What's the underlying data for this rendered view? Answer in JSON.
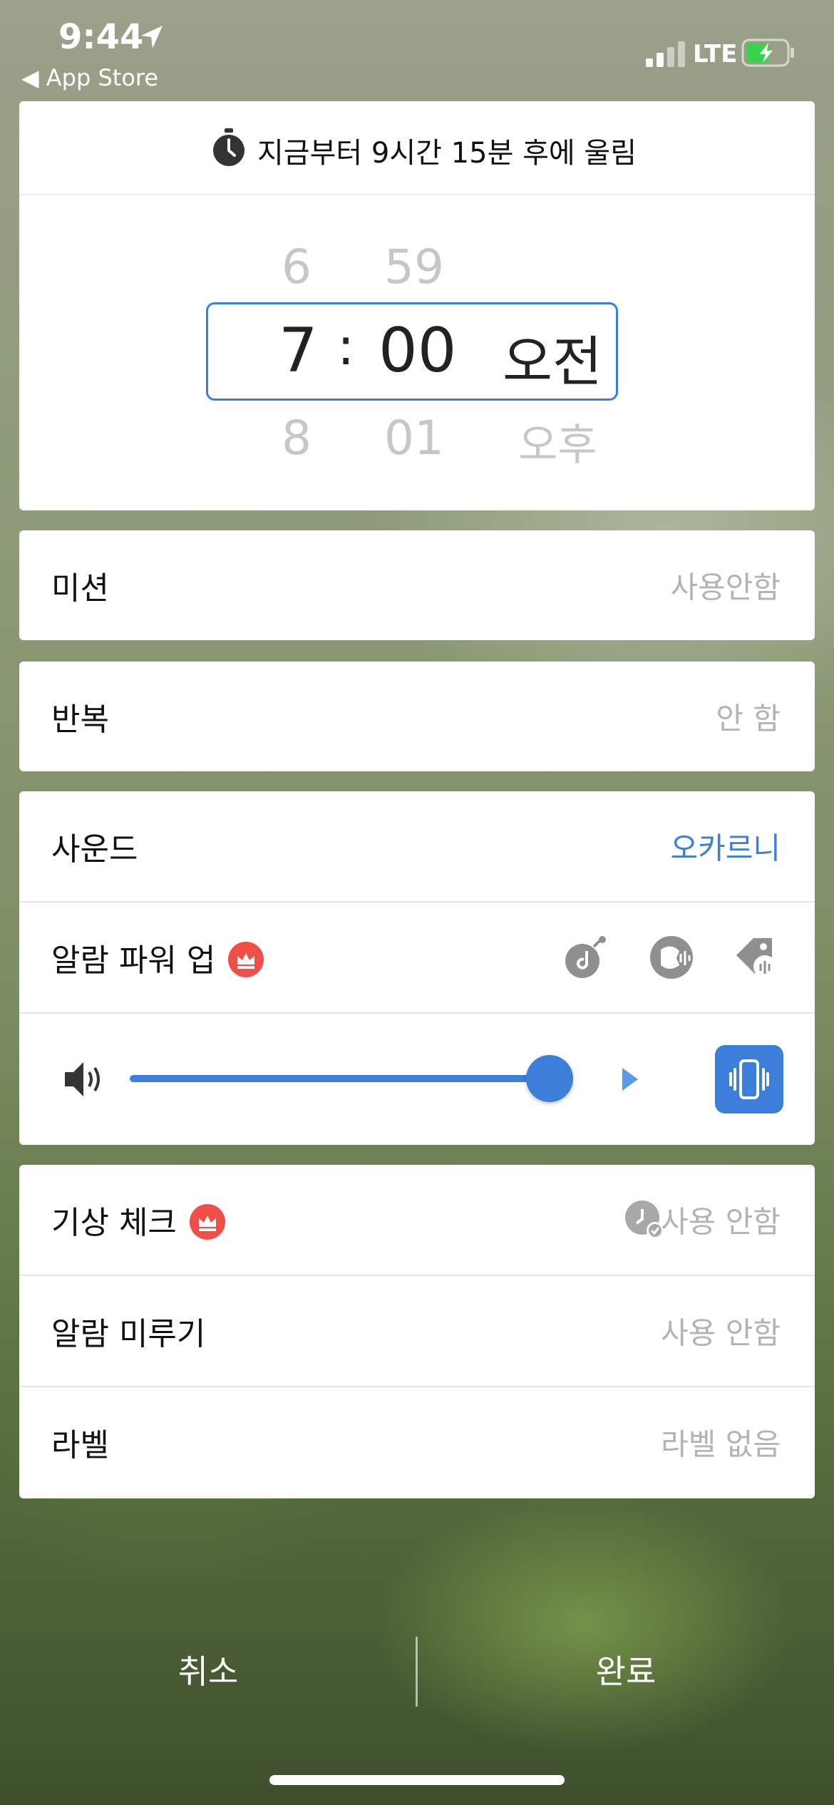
{
  "status_bar": {
    "time": "9:44",
    "back_label": "◀ App Store",
    "network": "LTE"
  },
  "countdown": {
    "text": "지금부터 9시간 15분 후에 울림"
  },
  "picker": {
    "hour_prev": "6",
    "minute_prev": "59",
    "hour": "7",
    "separator": ":",
    "minute": "00",
    "period": "오전",
    "hour_next": "8",
    "minute_next": "01",
    "period_next": "오후"
  },
  "mission": {
    "label": "미션",
    "value": "사용안함"
  },
  "repeat": {
    "label": "반복",
    "value": "안 함"
  },
  "sound": {
    "label": "사운드",
    "value": "오카르니"
  },
  "powerup": {
    "label": "알람 파워 업"
  },
  "volume": {
    "level": 0.95
  },
  "wakeup_check": {
    "label": "기상 체크",
    "value": "사용 안함"
  },
  "snooze": {
    "label": "알람 미루기",
    "value": "사용 안함"
  },
  "label_row": {
    "label": "라벨",
    "value": "라벨 없음"
  },
  "footer": {
    "cancel": "취소",
    "done": "완료"
  },
  "colors": {
    "accent": "#3b7fdb",
    "crown": "#ef4f46"
  }
}
